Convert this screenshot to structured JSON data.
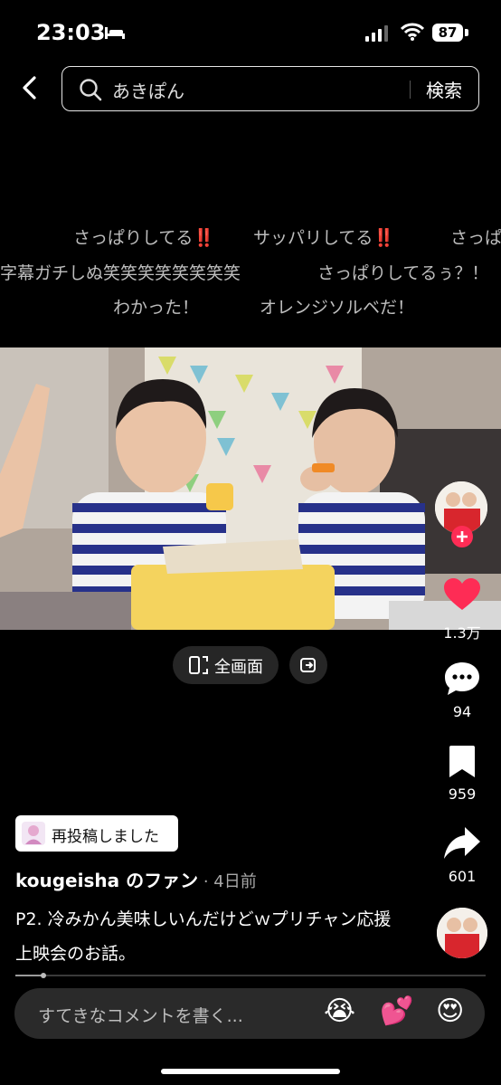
{
  "status_bar": {
    "time": "23:03",
    "battery": "87"
  },
  "search": {
    "query": "あきぽん",
    "button": "検索"
  },
  "danmaku": [
    {
      "text": "さっぱりしてる",
      "bang": "‼️"
    },
    {
      "text": "サッパリしてる",
      "bang": "‼️"
    },
    {
      "text": "さっぱ"
    },
    {
      "text": "字幕ガチしぬ笑笑笑笑笑笑笑笑"
    },
    {
      "text": "さっぱりしてるぅ？！"
    },
    {
      "text": "わかった！"
    },
    {
      "text": "オレンジソルベだ！"
    }
  ],
  "video_controls": {
    "fullscreen_label": "全画面"
  },
  "side_actions": {
    "likes": "1.3万",
    "comments": "94",
    "bookmarks": "959",
    "shares": "601"
  },
  "post": {
    "repost_label": "再投稿しました",
    "author": "kougeisha",
    "author_suffix": " のファン",
    "time_ago": " · 4日前",
    "caption": "P2. 冷みかん美味しいんだけどｗプリチャン応援上映会のお話。"
  },
  "progress": 0.06,
  "comment_bar": {
    "placeholder": "すてきなコメントを書く...",
    "emojis": [
      "😭",
      "💕",
      "😍"
    ]
  }
}
